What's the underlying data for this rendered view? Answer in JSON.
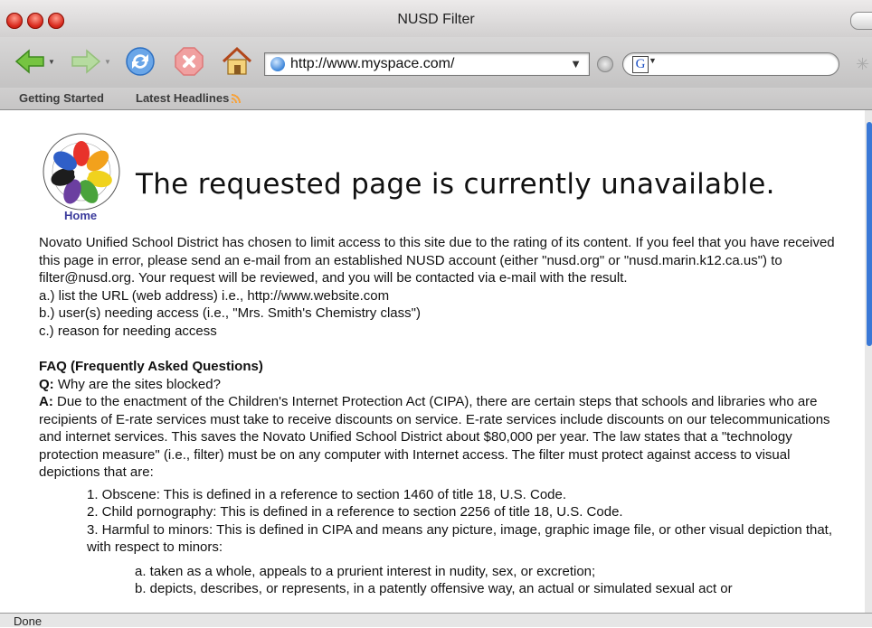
{
  "window": {
    "title": "NUSD Filter",
    "close_color": "#d8281c"
  },
  "toolbar": {
    "back_icon": "back-arrow-icon",
    "forward_icon": "forward-arrow-icon",
    "reload_icon": "reload-icon",
    "stop_icon": "stop-icon",
    "home_icon": "home-icon",
    "url": "http://www.myspace.com/",
    "search_engine": "G"
  },
  "bookmarks": [
    {
      "label": "Getting Started"
    },
    {
      "label": "Latest Headlines"
    }
  ],
  "page": {
    "logo_caption": "Home",
    "headline": "The requested page is currently unavailable.",
    "intro": "Novato Unified School District has chosen to limit access to this site due to the rating of its content. If you feel that you have received this page in error, please send an e-mail from an established NUSD account (either \"nusd.org\" or \"nusd.marin.k12.ca.us\") to filter@nusd.org. Your request will be reviewed, and you will be contacted via e-mail with the result.",
    "steps": [
      "a.) list the URL (web address) i.e., http://www.website.com",
      "b.) user(s) needing access (i.e., \"Mrs. Smith's Chemistry class\")",
      "c.) reason for needing access"
    ],
    "faq_heading": "FAQ (Frequently Asked Questions)",
    "q_label": "Q:",
    "question": "Why are the sites blocked?",
    "a_label": "A:",
    "answer": "Due to the enactment of the Children's Internet Protection Act (CIPA), there are certain steps that schools and libraries who are recipients of E-rate services must take to receive discounts on service. E-rate services include discounts on our telecommunications and internet services. This saves the Novato Unified School District about $80,000 per year. The law states that a \"technology protection measure\" (i.e., filter) must be on any computer with Internet access. The filter must protect against access to visual depictions that are:",
    "list": [
      "1. Obscene: This is defined in a reference to section 1460 of title 18, U.S. Code.",
      "2. Child pornography: This is defined in a reference to section 2256 of title 18, U.S. Code.",
      "3. Harmful to minors: This is defined in CIPA and means any picture, image, graphic image file, or other visual depiction that, with respect to minors:"
    ],
    "sublist": [
      "a. taken as a whole, appeals to a prurient interest in nudity, sex, or excretion;",
      "b. depicts, describes, or represents, in a patently offensive way, an actual or simulated sexual act or"
    ]
  },
  "status": {
    "text": "Done"
  }
}
